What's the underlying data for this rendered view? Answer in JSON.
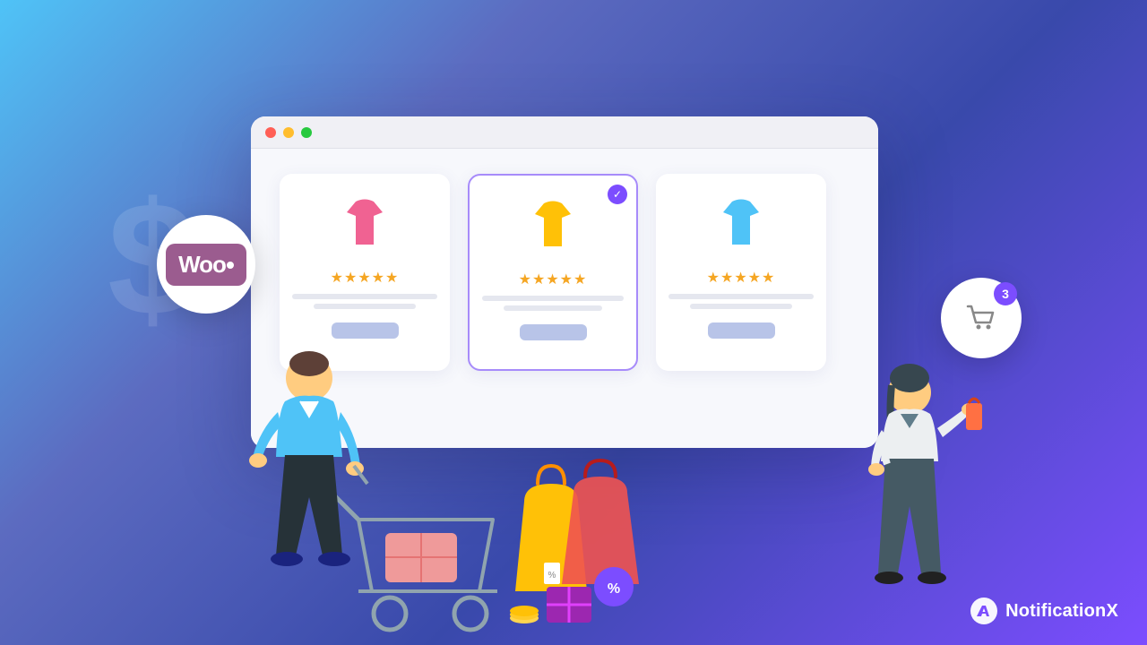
{
  "background": {
    "gradient_start": "#4fc3f7",
    "gradient_end": "#7c4dff"
  },
  "woo_badge": {
    "text": "Woo",
    "dot_visible": true
  },
  "cart_badge": {
    "count": "3"
  },
  "browser": {
    "dots": [
      "red",
      "yellow",
      "green"
    ],
    "products": [
      {
        "color": "pink",
        "stars": "★★★★★",
        "featured": false
      },
      {
        "color": "yellow",
        "stars": "★★★★★",
        "featured": true
      },
      {
        "color": "blue",
        "stars": "★★★★★",
        "featured": false
      }
    ]
  },
  "branding": {
    "name": "NotificationX"
  },
  "watermark": {
    "symbol": "$"
  }
}
